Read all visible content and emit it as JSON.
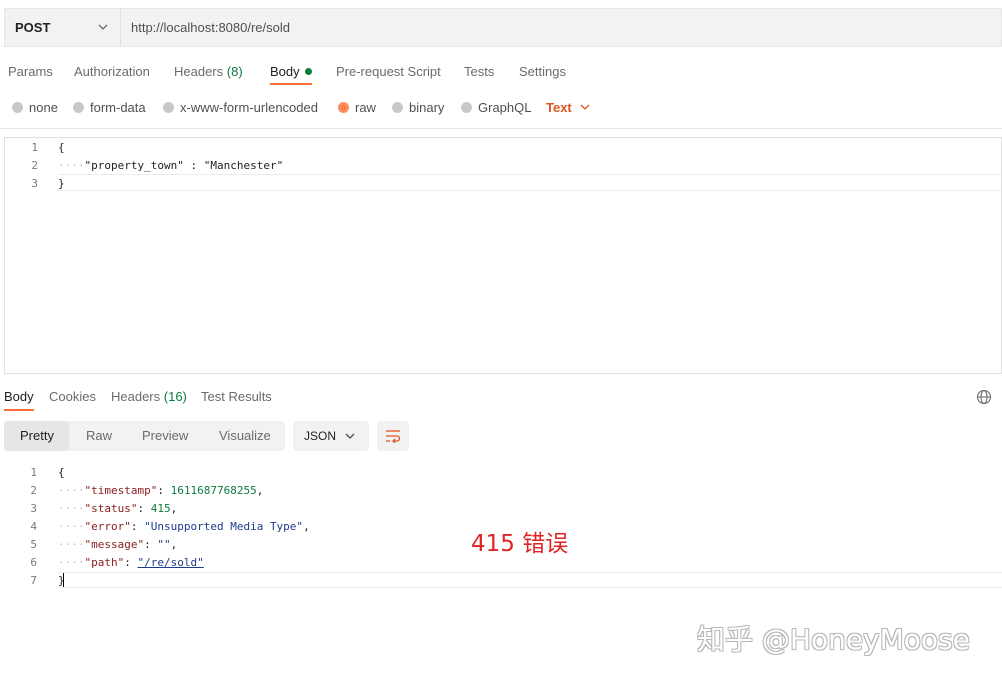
{
  "request": {
    "method": "POST",
    "url": "http://localhost:8080/re/sold"
  },
  "request_tabs": {
    "params": "Params",
    "authorization": "Authorization",
    "headers": "Headers",
    "headers_count": "(8)",
    "body": "Body",
    "prerequest": "Pre-request Script",
    "tests": "Tests",
    "settings": "Settings"
  },
  "body_types": {
    "none": "none",
    "form_data": "form-data",
    "urlencoded": "x-www-form-urlencoded",
    "raw": "raw",
    "binary": "binary",
    "graphql": "GraphQL",
    "selected_format": "Text",
    "selected": "raw"
  },
  "request_body": {
    "line_numbers": [
      "1",
      "2",
      "3"
    ],
    "line1": "{",
    "line2_key": "\"property_town\"",
    "line2_sep": " : ",
    "line2_value": "\"Manchester\"",
    "line3": "}"
  },
  "response_tabs": {
    "body": "Body",
    "cookies": "Cookies",
    "headers": "Headers",
    "headers_count": "(16)",
    "test_results": "Test Results"
  },
  "response_view": {
    "pretty": "Pretty",
    "raw": "Raw",
    "preview": "Preview",
    "visualize": "Visualize",
    "format": "JSON"
  },
  "response_body": {
    "line_numbers": [
      "1",
      "2",
      "3",
      "4",
      "5",
      "6",
      "7"
    ],
    "open": "{",
    "timestamp_key": "\"timestamp\"",
    "timestamp_value": "1611687768255",
    "status_key": "\"status\"",
    "status_value": "415",
    "error_key": "\"error\"",
    "error_value": "\"Unsupported Media Type\"",
    "message_key": "\"message\"",
    "message_value": "\"\"",
    "path_key": "\"path\"",
    "path_value": "\"/re/sold\"",
    "close": "}"
  },
  "annotation": "415 错误",
  "watermark": "知乎 @HoneyMoose",
  "colors": {
    "accent": "#ff6c37",
    "text_type": "#e0541f",
    "count_green": "#0c7b3e",
    "annotation_red": "#e02424"
  }
}
